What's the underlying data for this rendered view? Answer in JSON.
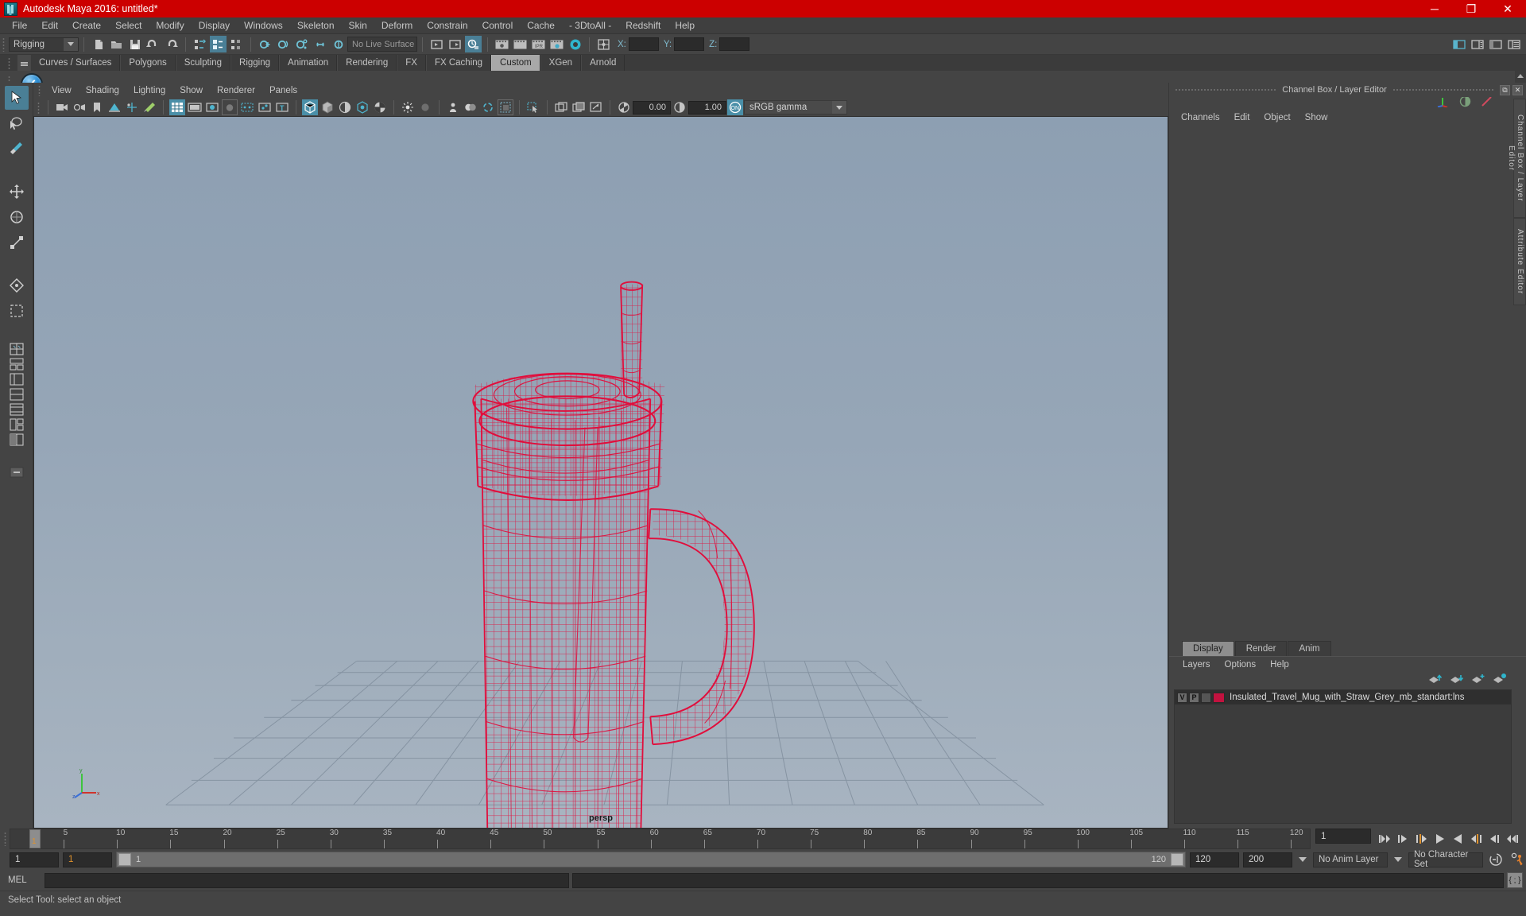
{
  "window": {
    "title": "Autodesk Maya 2016: untitled*",
    "app_icon": "maya-icon",
    "minimize": "─",
    "maximize": "❐",
    "close": "✕",
    "titlebar_color": "#cc0000"
  },
  "menubar": {
    "items": [
      {
        "label": "File"
      },
      {
        "label": "Edit"
      },
      {
        "label": "Create"
      },
      {
        "label": "Select"
      },
      {
        "label": "Modify"
      },
      {
        "label": "Display"
      },
      {
        "label": "Windows"
      },
      {
        "label": "Skeleton"
      },
      {
        "label": "Skin"
      },
      {
        "label": "Deform"
      },
      {
        "label": "Constrain"
      },
      {
        "label": "Control"
      },
      {
        "label": "Cache"
      },
      {
        "label": "- 3DtoAll -"
      },
      {
        "label": "Redshift"
      },
      {
        "label": "Help"
      }
    ]
  },
  "statusbar": {
    "mode_selector": "Rigging",
    "live_surface": "No Live Surface",
    "coord_x_label": "X:",
    "coord_y_label": "Y:",
    "coord_z_label": "Z:",
    "coord_x_value": "",
    "coord_y_value": "",
    "coord_z_value": ""
  },
  "shelf": {
    "tabs": [
      {
        "label": "Curves / Surfaces",
        "active": false
      },
      {
        "label": "Polygons",
        "active": false
      },
      {
        "label": "Sculpting",
        "active": false
      },
      {
        "label": "Rigging",
        "active": false
      },
      {
        "label": "Animation",
        "active": false
      },
      {
        "label": "Rendering",
        "active": false
      },
      {
        "label": "FX",
        "active": false
      },
      {
        "label": "FX Caching",
        "active": false
      },
      {
        "label": "Custom",
        "active": true
      },
      {
        "label": "XGen",
        "active": false
      },
      {
        "label": "Arnold",
        "active": false
      }
    ],
    "active_tab": "Custom",
    "button_icon": "blue-checkmark-icon"
  },
  "viewport": {
    "menu": [
      {
        "label": "View"
      },
      {
        "label": "Shading"
      },
      {
        "label": "Lighting"
      },
      {
        "label": "Show"
      },
      {
        "label": "Renderer"
      },
      {
        "label": "Panels"
      }
    ],
    "exposure_value": "0.00",
    "gamma_value": "1.00",
    "color_management": "sRGB gamma",
    "camera_label": "persp",
    "wireframe_color": "#e10e3c",
    "background_top": "#8d9fb2",
    "background_bottom": "#a3b0be",
    "axis_labels": {
      "x": "x",
      "y": "y",
      "z": "z"
    }
  },
  "channel_box": {
    "title": "Channel Box / Layer Editor",
    "menu": [
      {
        "label": "Channels"
      },
      {
        "label": "Edit"
      },
      {
        "label": "Object"
      },
      {
        "label": "Show"
      }
    ],
    "vertical_tabs": [
      "Channel Box / Layer Editor",
      "Attribute Editor"
    ]
  },
  "layer_editor": {
    "tabs": [
      {
        "label": "Display",
        "active": true
      },
      {
        "label": "Render",
        "active": false
      },
      {
        "label": "Anim",
        "active": false
      }
    ],
    "menu": [
      {
        "label": "Layers"
      },
      {
        "label": "Options"
      },
      {
        "label": "Help"
      }
    ],
    "layers": [
      {
        "visibility": "V",
        "playback": "P",
        "third": "",
        "color": "#c2123f",
        "name": "Insulated_Travel_Mug_with_Straw_Grey_mb_standart:lns"
      }
    ]
  },
  "timeline": {
    "ticks": [
      "5",
      "10",
      "15",
      "20",
      "25",
      "30",
      "35",
      "40",
      "45",
      "50",
      "55",
      "60",
      "65",
      "70",
      "75",
      "80",
      "85",
      "90",
      "95",
      "100",
      "105",
      "110",
      "115",
      "120"
    ],
    "current_frame_marker": "1",
    "current_frame_field": "1",
    "end_label": "120",
    "playback_buttons": [
      "go-to-start-icon",
      "step-back-keyframe-icon",
      "step-back-frame-icon",
      "play-backwards-icon",
      "play-forwards-icon",
      "step-forward-frame-icon",
      "step-forward-keyframe-icon",
      "go-to-end-icon"
    ]
  },
  "range_slider": {
    "start_field": "1",
    "range_start_field": "1",
    "slider_start_label": "1",
    "slider_end_label": "120",
    "range_end_field": "120",
    "end_field": "200",
    "anim_layer": "No Anim Layer",
    "character_set": "No Character Set",
    "auto_key_icon": "auto-keyframe-icon",
    "prefs_icon": "animation-preferences-icon"
  },
  "command_line": {
    "label": "MEL",
    "input_value": "",
    "output_value": "",
    "script_editor_icon": "script-editor-icon"
  },
  "status": {
    "help_text": "Select Tool: select an object"
  }
}
